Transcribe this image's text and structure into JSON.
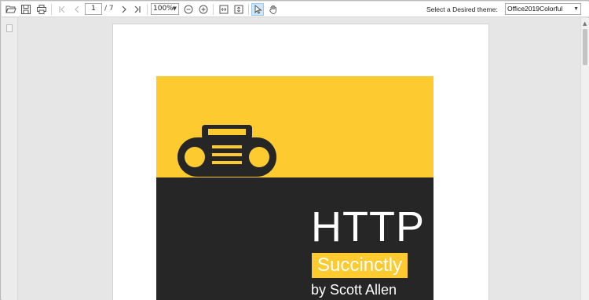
{
  "toolbar": {
    "open_icon": "folder-open-icon",
    "save_icon": "save-icon",
    "print_icon": "print-icon",
    "first_page_icon": "first-page-icon",
    "prev_page_icon": "prev-page-icon",
    "current_page": "1",
    "total_pages": "/ 7",
    "next_page_icon": "next-page-icon",
    "last_page_icon": "last-page-icon",
    "zoom_value": "100%",
    "zoom_out_icon": "zoom-out-icon",
    "zoom_in_icon": "zoom-in-icon",
    "fit_page_icon": "fit-page-icon",
    "fit_width_icon": "fit-width-icon",
    "select_tool_icon": "cursor-icon",
    "pan_tool_icon": "hand-icon",
    "theme_label": "Select a Desired theme:",
    "theme_value": "Office2019Colorful"
  },
  "document": {
    "title": "HTTP",
    "subtitle": "Succinctly",
    "author": "by Scott Allen",
    "cover_icon": "boombox-icon"
  },
  "colors": {
    "accent_yellow": "#fdcb2f",
    "cover_dark": "#262626",
    "active_tool": "#cfe6f8"
  }
}
